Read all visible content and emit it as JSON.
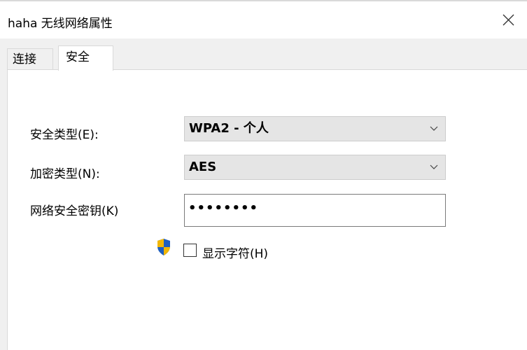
{
  "window": {
    "title": "haha 无线网络属性"
  },
  "tabs": [
    {
      "label": "连接"
    },
    {
      "label": "安全"
    }
  ],
  "security": {
    "security_type_label": "安全类型(E):",
    "security_type_value": "WPA2 - 个人",
    "encryption_type_label": "加密类型(N):",
    "encryption_type_value": "AES",
    "network_key_label": "网络安全密钥(K)",
    "network_key_masked": "••••••••",
    "show_chars_label": "显示字符(H)",
    "show_chars_checked": false
  },
  "icons": {
    "close": "close-icon",
    "dropdown": "chevron-down-icon",
    "uac_shield": "shield-icon"
  },
  "colors": {
    "shield_blue": "#1f5fbf",
    "shield_yellow": "#f2b705"
  }
}
